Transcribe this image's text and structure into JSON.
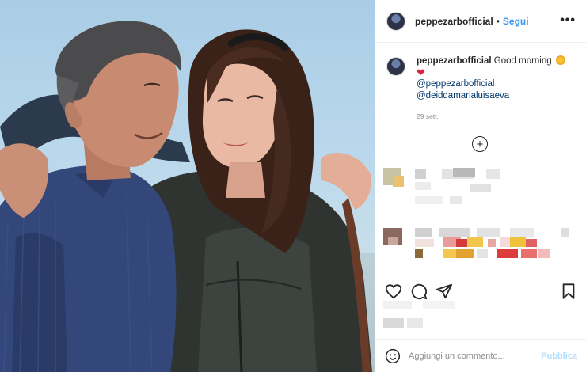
{
  "post": {
    "username": "peppezarbofficial",
    "follow_label": "Segui",
    "separator": "•",
    "more_label": "•••"
  },
  "caption": {
    "username": "peppezarbofficial",
    "text": "Good morning",
    "emoji_sun": "sun-emoji",
    "emoji_heart": "❤",
    "mentions": [
      "@peppezarbofficial",
      "@deiddamarialuisaeva"
    ],
    "date": "29 sett."
  },
  "load_more": "+",
  "actions": {
    "icons": [
      "heart-icon",
      "comment-icon",
      "share-icon",
      "bookmark-icon"
    ]
  },
  "comment": {
    "placeholder": "Aggiungi un commento...",
    "publish_label": "Pubblica"
  },
  "colors": {
    "link": "#3897f0",
    "mention": "#00376b",
    "publish_disabled": "#b2dffc",
    "muted": "#8e8e8e"
  }
}
